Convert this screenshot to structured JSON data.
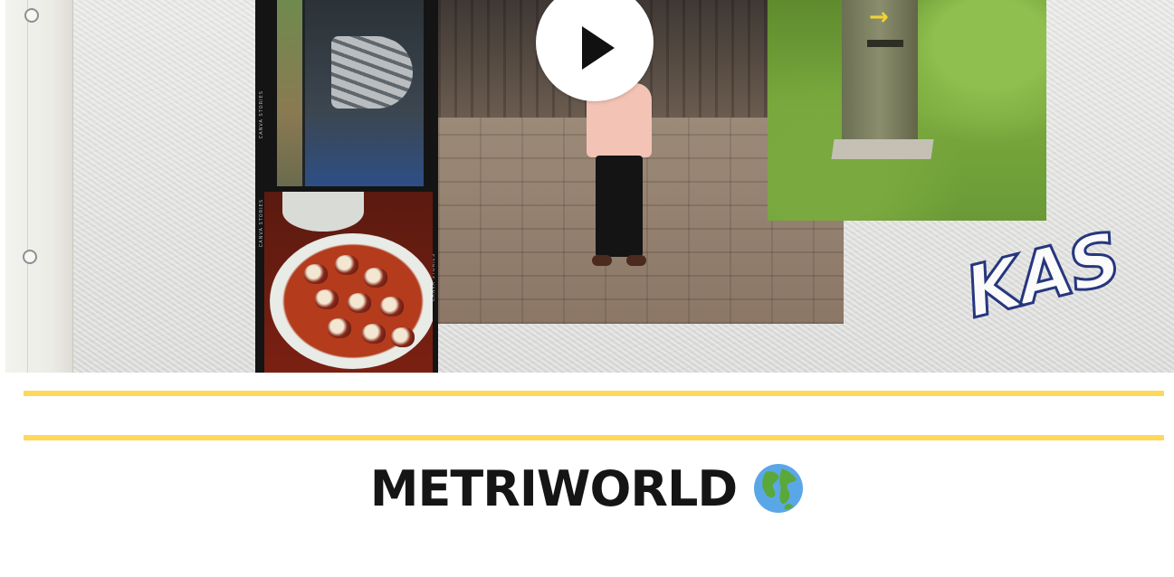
{
  "video": {
    "stamp_text": "KAS",
    "pillar_arrow": "→",
    "film_label": "CANVA STORIES"
  },
  "play_button": {
    "icon": "play-icon"
  },
  "page": {
    "title": "METRIWORLD",
    "title_icon": "globe-icon"
  },
  "colors": {
    "divider": "#fdd85a",
    "title_text": "#151515",
    "stamp_stroke": "#26367f"
  }
}
